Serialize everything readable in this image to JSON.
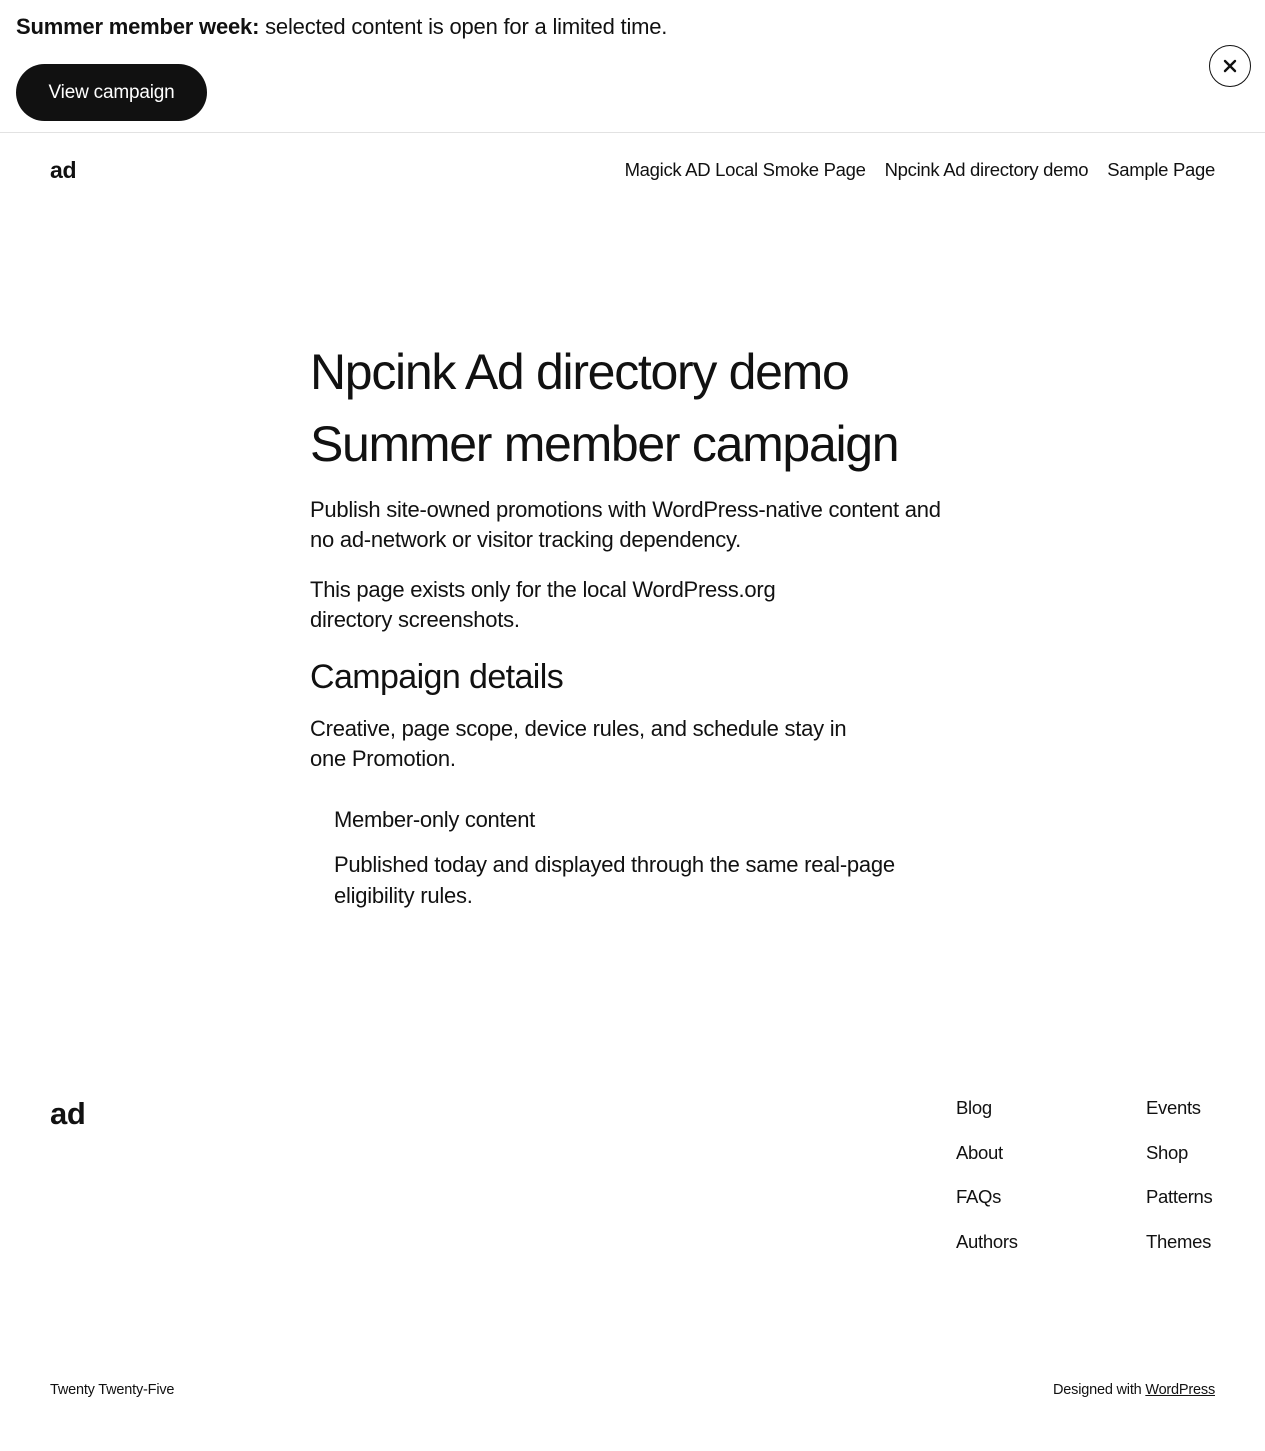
{
  "banner": {
    "headline": "Summer member week",
    "separator": ":",
    "message": " selected content is open for a limited time.",
    "cta_label": "View campaign",
    "close_icon": "close-icon"
  },
  "header": {
    "site_title": "ad",
    "nav": [
      {
        "label": "Magick AD Local Smoke Page"
      },
      {
        "label": "Npcink Ad directory demo"
      },
      {
        "label": "Sample Page"
      }
    ]
  },
  "main": {
    "page_title": "Npcink Ad directory demo",
    "campaign_title": "Summer member campaign",
    "intro": "Publish site-owned promotions with WordPress-native content and no ad-network or visitor tracking dependency.",
    "note": "This page exists only for the local WordPress.org directory screenshots.",
    "details_heading": "Campaign details",
    "details_text": "Creative, page scope, device rules, and schedule stay in one Promotion.",
    "member_card": {
      "title": "Member-only content",
      "body": "Published today and displayed through the same real-page eligibility rules."
    }
  },
  "footer": {
    "logo": "ad",
    "col1": [
      {
        "label": "Blog"
      },
      {
        "label": "About"
      },
      {
        "label": "FAQs"
      },
      {
        "label": "Authors"
      }
    ],
    "col2": [
      {
        "label": "Events"
      },
      {
        "label": "Shop"
      },
      {
        "label": "Patterns"
      },
      {
        "label": "Themes"
      }
    ],
    "theme_name": "Twenty Twenty-Five",
    "credit_prefix": "Designed with ",
    "credit_link": "WordPress"
  },
  "colors": {
    "text": "#111111",
    "background": "#ffffff",
    "button_bg": "#111111",
    "button_text": "#ffffff",
    "divider": "#e2e2e2"
  }
}
